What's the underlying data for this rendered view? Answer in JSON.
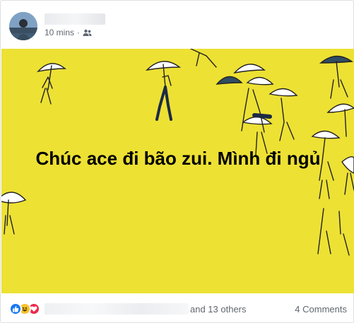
{
  "post": {
    "time": "10 mins",
    "audience_icon": "friends-icon",
    "status_text": "Chúc ace đi bão zui. Mình đi ngủ",
    "background_color": "#ede134",
    "reactions": {
      "icons": [
        "like-icon",
        "haha-icon",
        "love-icon"
      ],
      "others_text": "and 13 others",
      "comments_text": "4 Comments"
    }
  }
}
